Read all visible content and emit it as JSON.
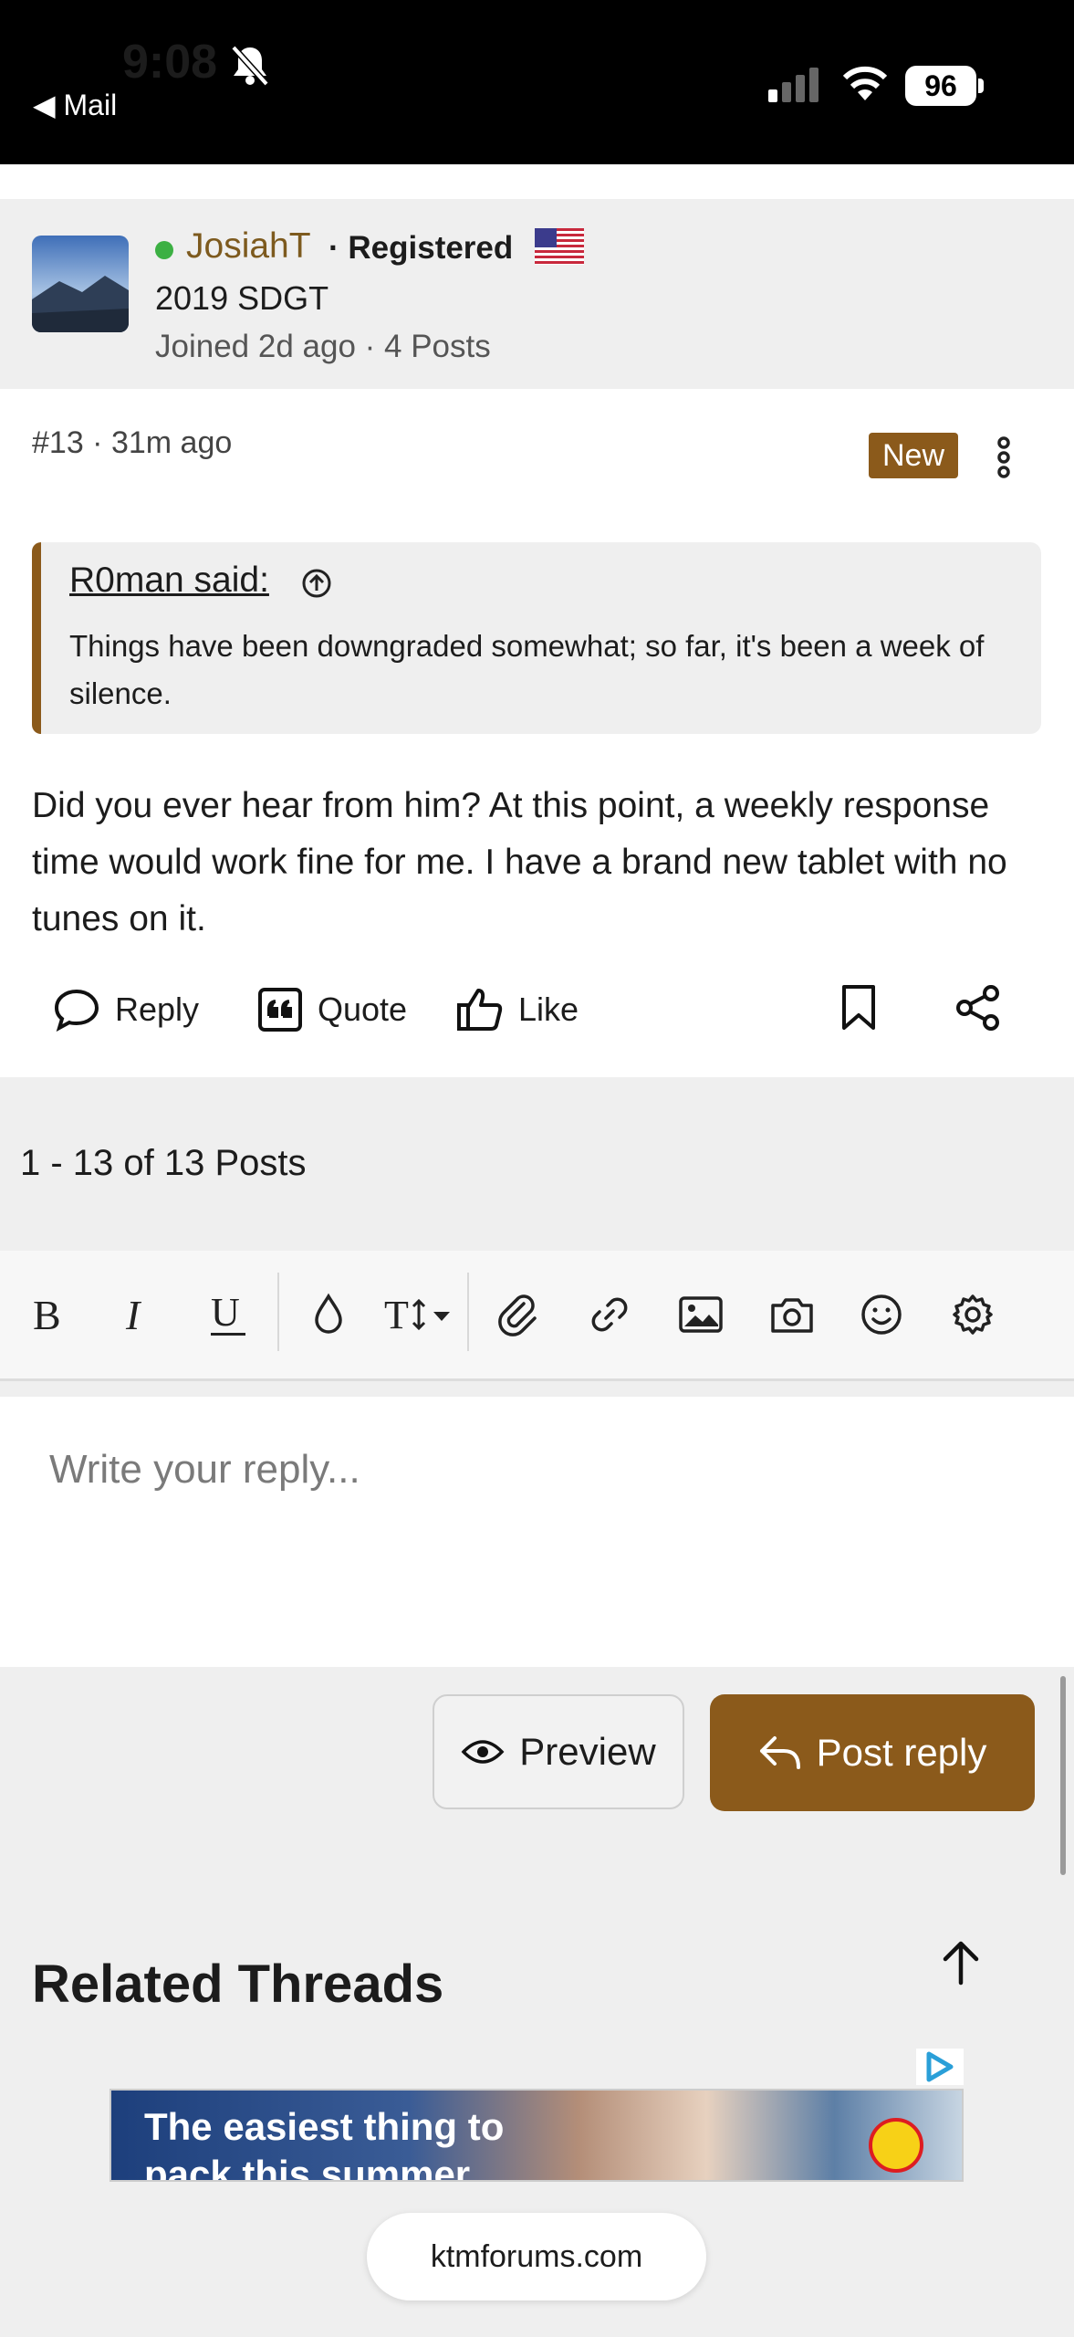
{
  "status_bar": {
    "time": "9:08",
    "back_label": "◀ Mail",
    "battery": "96"
  },
  "post": {
    "author": {
      "name": "JosiahT",
      "role": "· Registered",
      "bike": "2019 SDGT",
      "joined": "Joined 2d ago · 4 Posts"
    },
    "meta": "#13 · 31m ago",
    "badge": "New",
    "quote": {
      "author": "R0man said:",
      "text": "Things have been downgraded somewhat; so far, it's been a week of silence."
    },
    "body": "Did you ever hear from him? At this point, a weekly response time would work fine for me. I have a brand new tablet with no tunes on it.",
    "actions": {
      "reply": "Reply",
      "quote": "Quote",
      "like": "Like"
    }
  },
  "pagination": "1 - 13 of 13 Posts",
  "editor": {
    "placeholder": "Write your reply...",
    "toolbar": [
      "bold-icon",
      "italic-icon",
      "underline-icon",
      "color-drop-icon",
      "text-size-icon",
      "attachment-icon",
      "link-icon",
      "image-icon",
      "camera-icon",
      "emoji-icon",
      "settings-icon"
    ]
  },
  "buttons": {
    "preview": "Preview",
    "post_reply": "Post reply"
  },
  "related": {
    "title": "Related Threads"
  },
  "ad": {
    "headline": "The easiest thing to pack this summer"
  },
  "url_bar": {
    "domain": "ktmforums.com"
  },
  "colors": {
    "accent": "#8b5a1b",
    "online": "#3cb043",
    "username": "#7d5a1e"
  }
}
